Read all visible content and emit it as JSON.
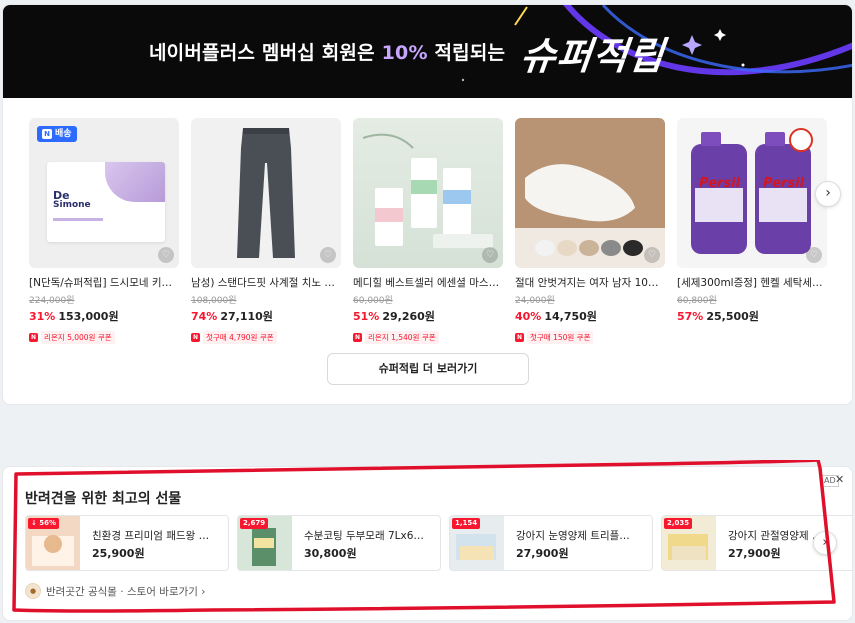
{
  "banner": {
    "text_before": "네이버플러스 멤버십 회원은 ",
    "text_highlight": "10%",
    "text_after": " 적립되는",
    "logo": "슈퍼적립"
  },
  "products": [
    {
      "badge": "배송",
      "thumb_label_1": "De",
      "thumb_label_2": "Simone",
      "title": "[N단독/슈퍼적립] 드시모네 키즈…",
      "orig_price": "224,000원",
      "rate": "31%",
      "price": "153,000원",
      "coupon": "리온지 5,000원 쿠폰"
    },
    {
      "title": "남성) 스탠다드핏 사계절 치노 …",
      "orig_price": "108,000원",
      "rate": "74%",
      "price": "27,110원",
      "coupon": "첫구매 4,790원 쿠폰"
    },
    {
      "title": "메디힐 베스트셀러 에센셜 마스…",
      "orig_price": "60,000원",
      "rate": "51%",
      "price": "29,260원",
      "coupon": "리온지 1,540원 쿠폰"
    },
    {
      "title": "절대 안벗겨지는 여자 남자 10…",
      "orig_price": "24,000원",
      "rate": "40%",
      "price": "14,750원",
      "coupon": "첫구매 150원 쿠폰"
    },
    {
      "brand": "Persil",
      "title": "[세제300ml증정] 헨켈 세탁세제 …",
      "orig_price": "60,800원",
      "rate": "57%",
      "price": "25,500원",
      "coupon": ""
    }
  ],
  "more_button": "슈퍼적립 더 보러가기",
  "ad": {
    "title": "반려견을 위한 최고의 선물",
    "ad_label": "AD",
    "close": "✕",
    "items": [
      {
        "badge": "↓ 56%",
        "name": "친환경 프리미엄 패드왕 …",
        "price": "25,900원"
      },
      {
        "badge": "2,679",
        "name": "수분코팅 두부모래 7Lx6…",
        "price": "30,800원"
      },
      {
        "badge": "1,154",
        "name": "강아지 눈영양제 트리플…",
        "price": "27,900원"
      },
      {
        "badge": "2,035",
        "name": "강아지 관절영양제 …",
        "price": "27,900원"
      }
    ],
    "store_link": "반려곳간 공식몰 · 스토어 바로가기 ›"
  },
  "icons": {
    "next": "›",
    "heart": "♡"
  },
  "colors": {
    "accent_red": "#f7172f",
    "banner_bg": "#0a0a0a",
    "highlight_purple": "#c8a6ff",
    "annotation_red": "#e0102c"
  }
}
